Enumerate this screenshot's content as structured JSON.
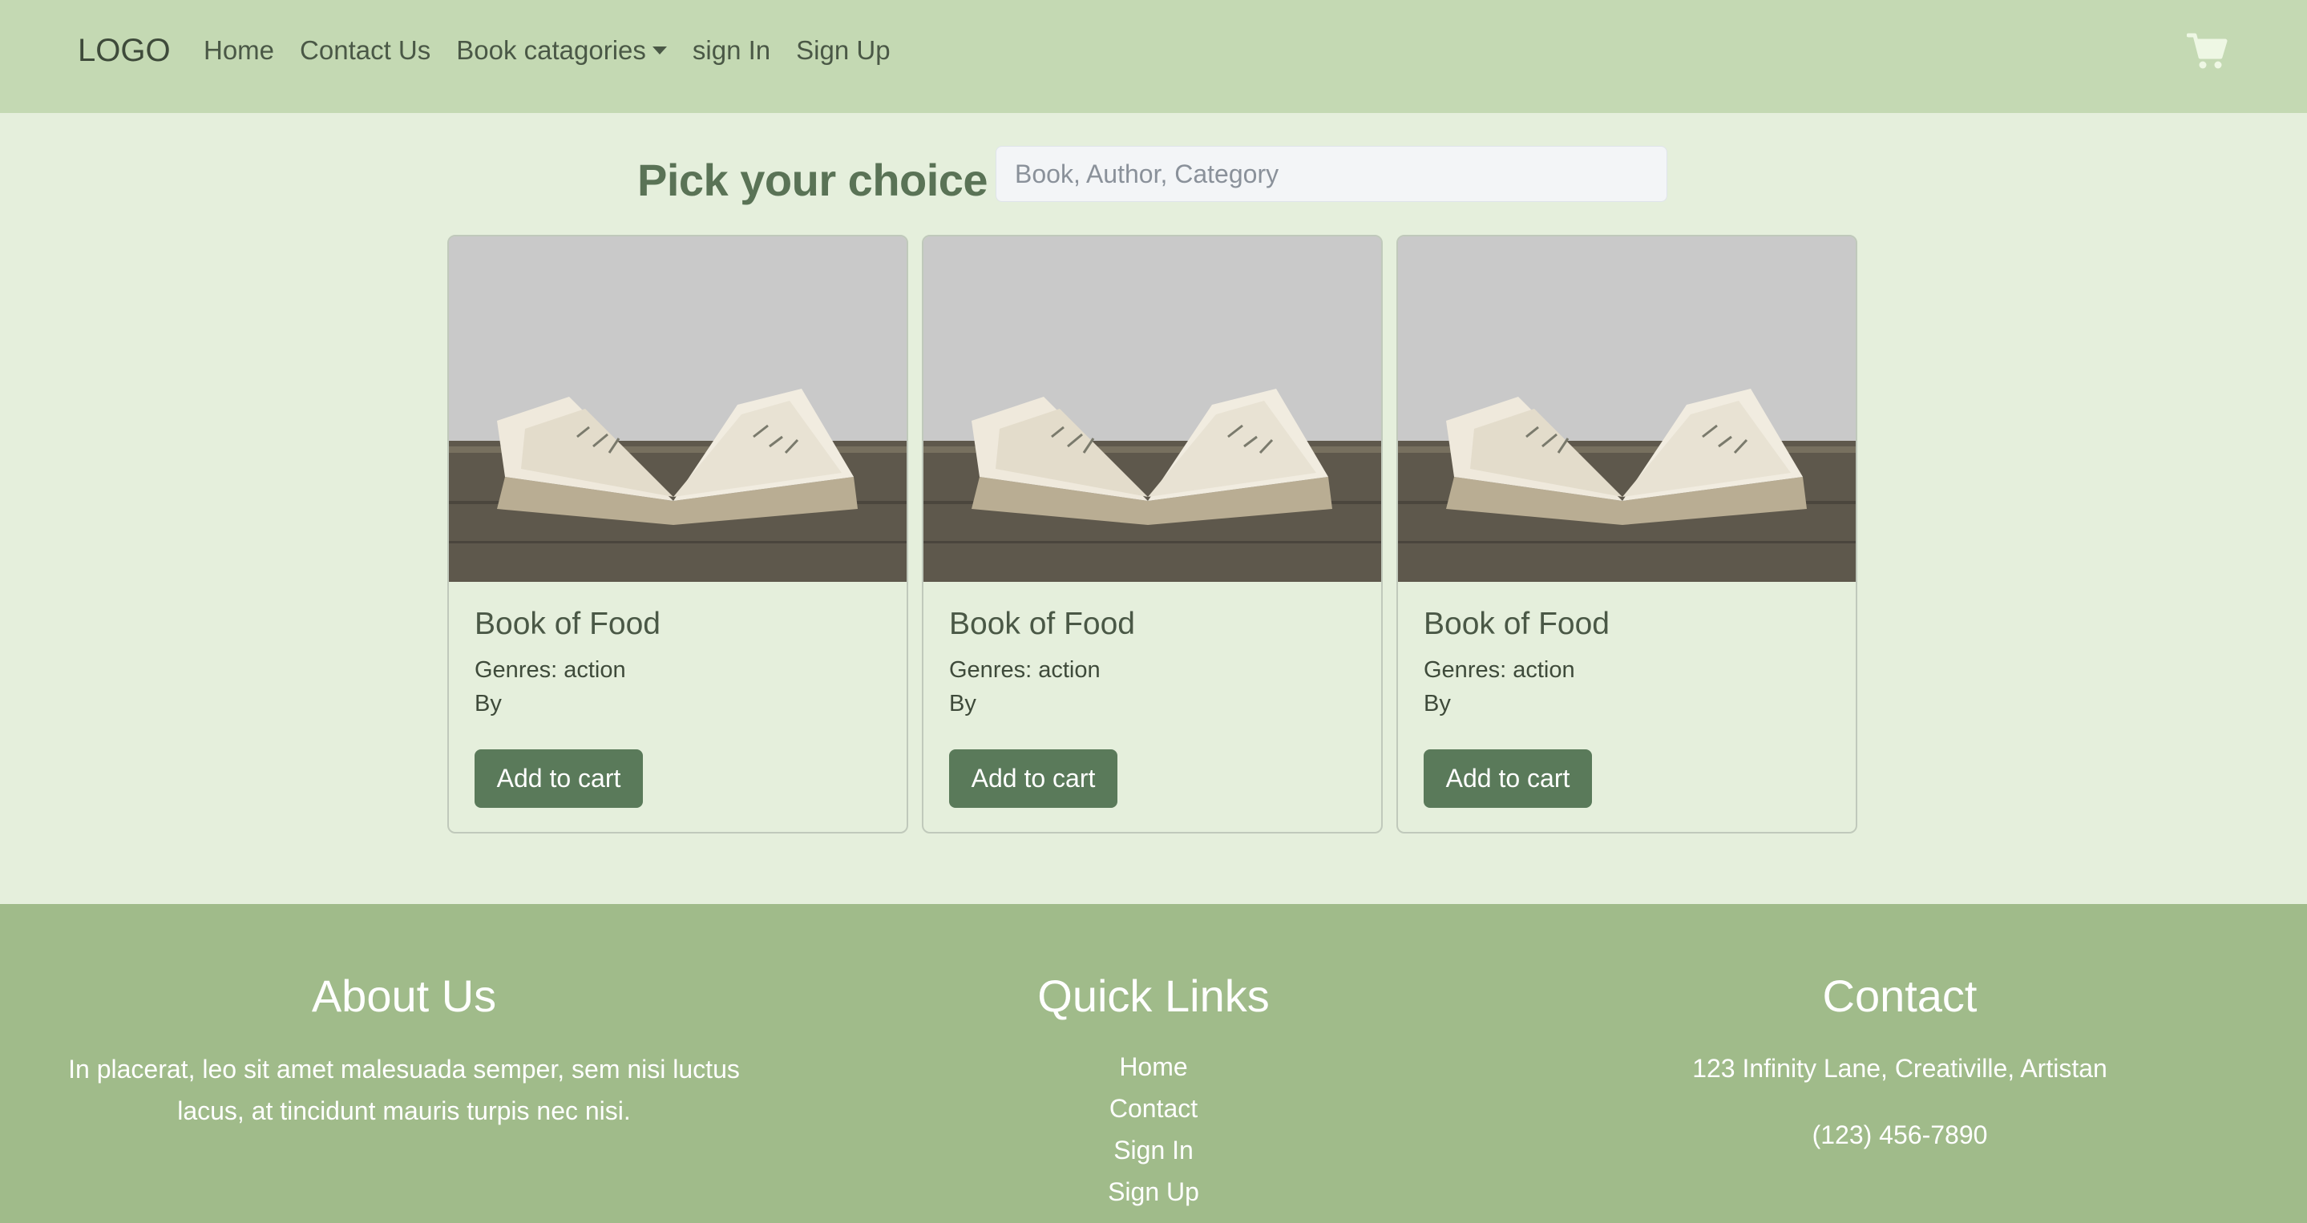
{
  "navbar": {
    "logo": "LOGO",
    "links": [
      {
        "label": "Home"
      },
      {
        "label": "Contact Us"
      },
      {
        "label": "Book catagories"
      },
      {
        "label": "sign In"
      },
      {
        "label": "Sign Up"
      }
    ],
    "cart_icon": "shopping-cart-icon",
    "cart_color": "#eef7e4"
  },
  "search": {
    "heading": "Pick your choice",
    "placeholder": "Book, Author, Category",
    "value": ""
  },
  "cards": [
    {
      "title": "Book of Food",
      "genres": "Genres: action",
      "by": "By",
      "button": "Add to cart",
      "image": "open-book-image"
    },
    {
      "title": "Book of Food",
      "genres": "Genres: action",
      "by": "By",
      "button": "Add to cart",
      "image": "open-book-image"
    },
    {
      "title": "Book of Food",
      "genres": "Genres: action",
      "by": "By",
      "button": "Add to cart",
      "image": "open-book-image"
    }
  ],
  "footer": {
    "about": {
      "heading": "About Us",
      "text": "In placerat, leo sit amet malesuada semper, sem nisi luctus lacus, at tincidunt mauris turpis nec nisi."
    },
    "quick_links": {
      "heading": "Quick Links",
      "items": [
        "Home",
        "Contact",
        "Sign In",
        "Sign Up"
      ]
    },
    "contact": {
      "heading": "Contact",
      "address": "123 Infinity Lane, Creativille, Artistan",
      "phone": "(123) 456-7890"
    }
  },
  "colors": {
    "navbar_bg": "#c4d9b3",
    "page_bg": "#e5efdc",
    "accent_button": "#5a7a5a",
    "heading_green": "#5a7356",
    "footer_bg": "#a0bb8a"
  }
}
